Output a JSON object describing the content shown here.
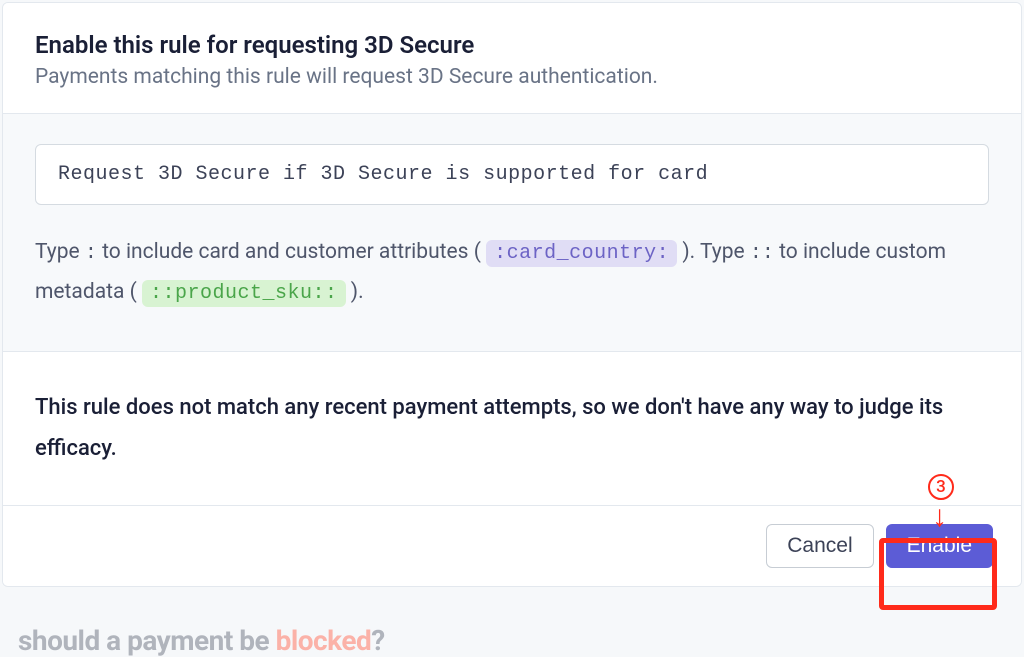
{
  "header": {
    "title": "Enable this rule for requesting 3D Secure",
    "subtitle": "Payments matching this rule will request 3D Secure authentication."
  },
  "body": {
    "rule_text": "Request 3D Secure if 3D Secure is supported for card",
    "hint_part1": "Type ",
    "hint_token1": ":",
    "hint_part2": " to include card and customer attributes ( ",
    "hint_pill1": ":card_country:",
    "hint_part3": " ). Type ",
    "hint_token2": "::",
    "hint_part4": " to include custom metadata ( ",
    "hint_pill2": "::product_sku::",
    "hint_part5": " )."
  },
  "result": {
    "text": "This rule does not match any recent payment attempts, so we don't have any way to judge its efficacy."
  },
  "footer": {
    "cancel_label": "Cancel",
    "enable_label": "Enable"
  },
  "annotations": {
    "step_number": "3"
  },
  "background": {
    "text_part1": "should a payment be ",
    "text_blocked": "blocked",
    "text_part2": "?"
  },
  "colors": {
    "primary_button": "#5c5cd6",
    "highlight": "#ff2a1a",
    "pill_purple_bg": "#e0ddf5",
    "pill_green_bg": "#d8f3d2"
  }
}
